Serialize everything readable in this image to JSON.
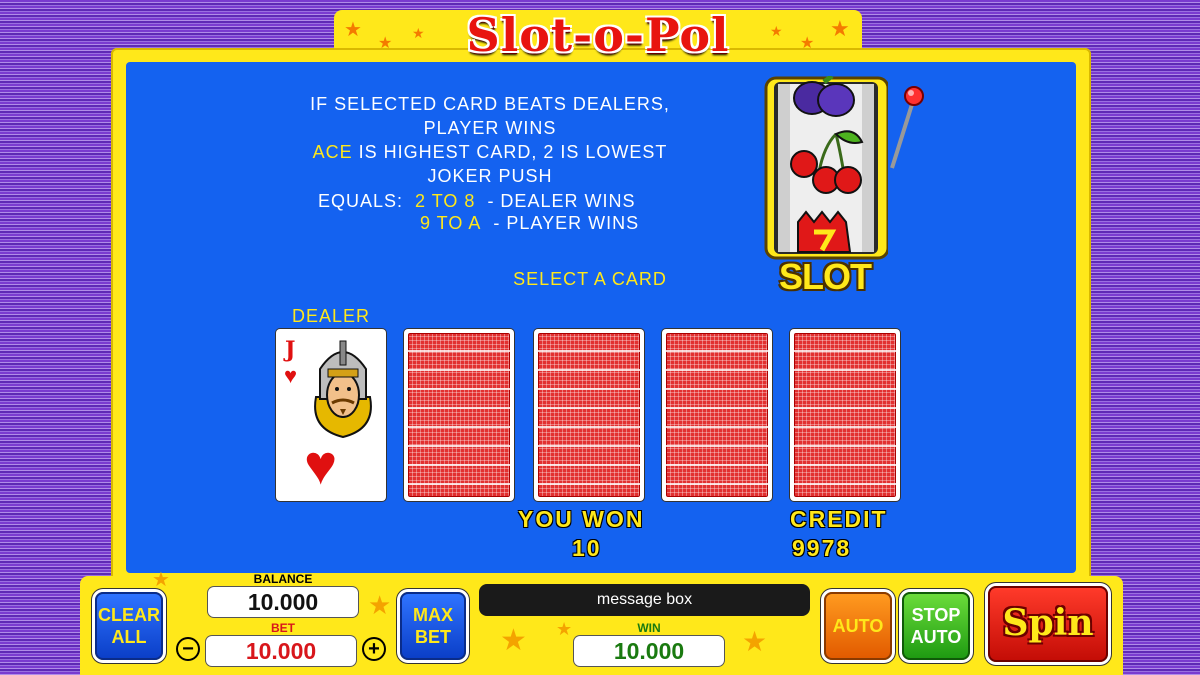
{
  "game": {
    "title": "Slot-o-Pol",
    "slot_logo": "SLOT"
  },
  "rules": {
    "line1": "IF SELECTED CARD BEATS DEALERS,",
    "line2": "PLAYER WINS",
    "line3_highlight": "ACE",
    "line3_rest": " IS HIGHEST CARD, 2 IS LOWEST",
    "line4": "JOKER PUSH",
    "equals_label": "EQUALS:",
    "equals_row1_range": "2 TO 8",
    "equals_row1_result": "-  DEALER WINS",
    "equals_row2_range": "9 TO A",
    "equals_row2_result": "-  PLAYER WINS"
  },
  "prompt": "SELECT A CARD",
  "dealer": {
    "label": "DEALER",
    "card_rank": "J",
    "card_suit": "♥"
  },
  "result": {
    "won_label": "YOU WON",
    "won_value": "10",
    "credit_label": "CREDIT",
    "credit_value": "9978"
  },
  "controls": {
    "clear_all": "CLEAR ALL",
    "balance_label": "BALANCE",
    "balance_value": "10.000",
    "bet_label": "BET",
    "bet_value": "10.000",
    "minus": "−",
    "plus": "+",
    "max_bet": "MAX BET",
    "message_box": "message box",
    "win_label": "WIN",
    "win_value": "10.000",
    "auto": "AUTO",
    "stop_auto": "STOP AUTO",
    "spin": "Spin"
  },
  "colors": {
    "panel_blue": "#1462f0",
    "frame_yellow": "#ffe81a",
    "highlight_yellow": "#ffe81a",
    "card_red": "#e23030",
    "bet_red": "#d8161b",
    "win_green": "#1a7a10"
  },
  "icons": {
    "slot_machine": "slot-machine-icon",
    "plum": "plum-icon",
    "cherries": "cherries-icon",
    "seven": "seven-icon",
    "jack_face": "jack-face-icon"
  }
}
